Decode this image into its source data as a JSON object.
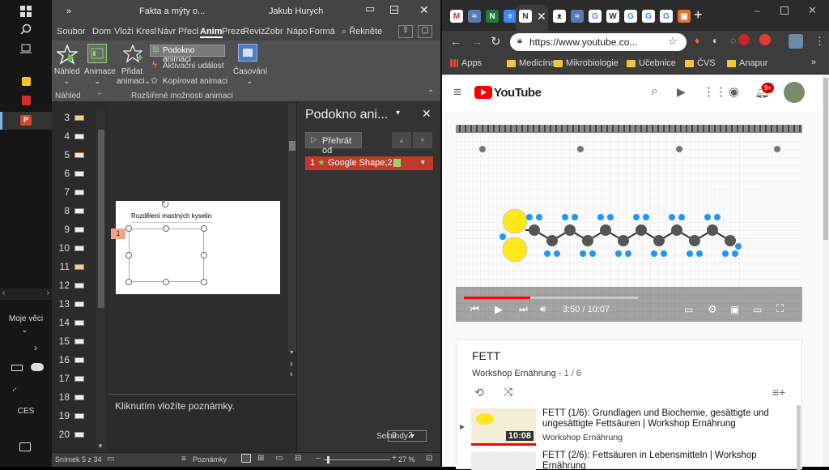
{
  "taskbar": {
    "moje_veci": "Moje věci",
    "ces": "CES"
  },
  "ppt": {
    "title": "Fakta a mýty o...",
    "user": "Jakub Hurych",
    "tabs": [
      "Soubor",
      "Dom",
      "Vloži",
      "Kresl",
      "Návr",
      "Přecl",
      "Anim",
      "Preze",
      "Reviz",
      "Zobr",
      "Nápo",
      "Formá"
    ],
    "tell_me": "Řekněte",
    "ribbon": {
      "nahled": "Náhled",
      "animace": "Animace",
      "pridat_line1": "Přidat",
      "pridat_line2": "animaci",
      "podokno": "Podokno animací",
      "aktivacni": "Aktivační událost",
      "kopirovat": "Kopírovat animaci",
      "casovani": "Časování",
      "group_nahled": "Náhled",
      "group_rozsirene": "Rozšířené možnosti animací"
    },
    "slides": [
      "3",
      "4",
      "5",
      "6",
      "7",
      "8",
      "9",
      "10",
      "11",
      "12",
      "13",
      "14",
      "15",
      "16",
      "17",
      "18",
      "19",
      "20"
    ],
    "slide_title": "Rozdělení mastných kyselin",
    "anim_tag": "1",
    "notes_placeholder": "Kliknutím vložíte poznámky.",
    "anim_pane": {
      "title": "Podokno ani...",
      "play_from": "Přehrát od",
      "item_num": "1",
      "item_label": "Google Shape;2...",
      "seconds": "Sekundy",
      "zoom_start": "0",
      "zoom_end": "2"
    },
    "status": {
      "slide_info": "Snímek 5 z 34",
      "notes": "Poznámky",
      "zoom": "27 %"
    }
  },
  "chrome": {
    "url": "https://www.youtube.co...",
    "bookmarks": [
      "Apps",
      "Medicína",
      "Mikrobiologie",
      "Učebnice",
      "ČVS",
      "Anapur"
    ],
    "yt_logo": "YouTube",
    "notif_count": "9+",
    "video": {
      "time_current": "3:50",
      "time_total": "10:07",
      "time_display": "3:50 / 10:07",
      "progress": 0.38
    },
    "playlist": {
      "title": "FETT",
      "channel": "Workshop Ernährung",
      "position": " - 1 / 6",
      "items": [
        {
          "title": "FETT (1/6): Grundlagen und Biochemie, gesättigte und ungesättigte Fettsäuren | Workshop Ernährung",
          "channel": "Workshop Ernährung",
          "duration": "10:08"
        },
        {
          "title": "FETT (2/6): Fettsäuren in Lebensmitteln | Workshop Ernährung",
          "channel": "",
          "duration": ""
        }
      ]
    },
    "colors": {
      "yt_red": "#ff0000",
      "accent_blue": "#1a73e8"
    }
  }
}
